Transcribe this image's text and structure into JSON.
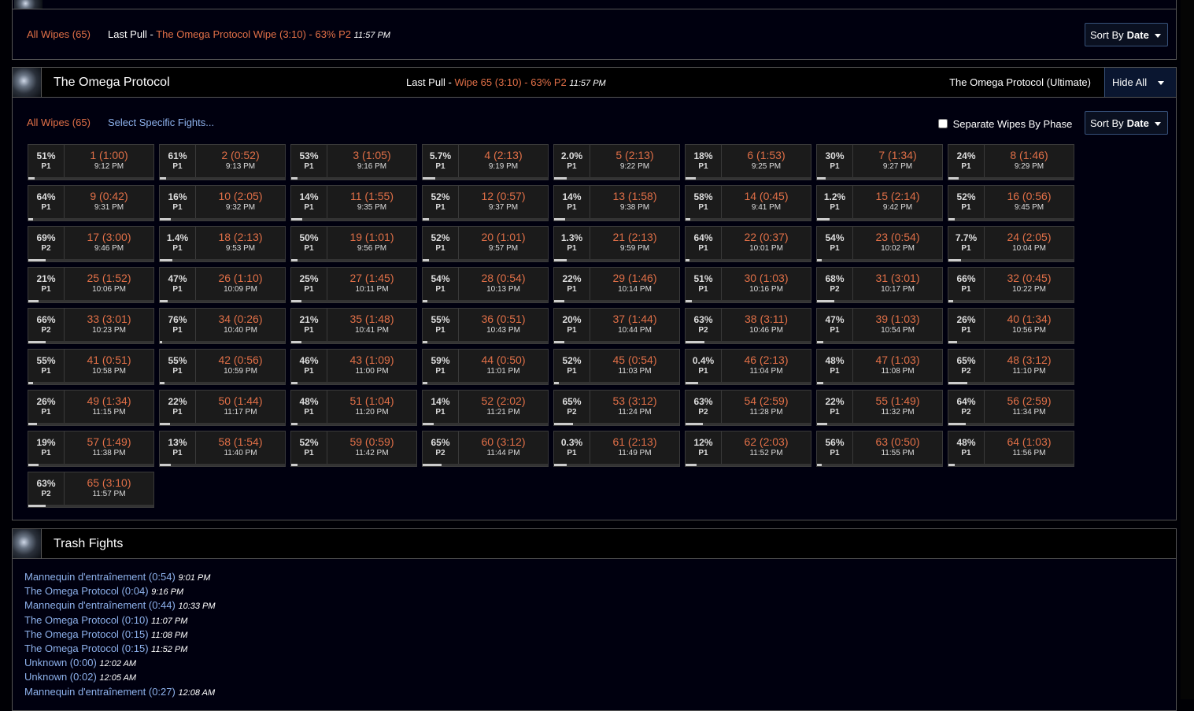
{
  "top": {
    "all_wipes": "All Wipes (65)",
    "last_pull_label": "Last Pull",
    "sep": " - ",
    "last_pull_link": "The Omega Protocol Wipe (3:10) - 63% P2",
    "last_pull_time": "11:57 PM",
    "sort_label": "Sort By",
    "sort_value": "Date"
  },
  "omega": {
    "title": "The Omega Protocol",
    "last_pull_label": "Last Pull",
    "sep": " - ",
    "last_pull_link": "Wipe 65 (3:10) - 63% P2",
    "last_pull_time": "11:57 PM",
    "difficulty": "The Omega Protocol (Ultimate)",
    "hide_all": "Hide All",
    "all_wipes": "All Wipes (65)",
    "select_fights": "Select Specific Fights...",
    "separate_label": "Separate Wipes By Phase",
    "sort_label": "Sort By",
    "sort_value": "Date"
  },
  "fights": [
    {
      "pct": "51%",
      "phase": "P1",
      "num": "1 (1:00)",
      "time": "9:12 PM",
      "frac": 0.05
    },
    {
      "pct": "61%",
      "phase": "P1",
      "num": "2 (0:52)",
      "time": "9:13 PM",
      "frac": 0.05
    },
    {
      "pct": "53%",
      "phase": "P1",
      "num": "3 (1:05)",
      "time": "9:16 PM",
      "frac": 0.05
    },
    {
      "pct": "5.7%",
      "phase": "P1",
      "num": "4 (2:13)",
      "time": "9:19 PM",
      "frac": 0.1
    },
    {
      "pct": "2.0%",
      "phase": "P1",
      "num": "5 (2:13)",
      "time": "9:22 PM",
      "frac": 0.1
    },
    {
      "pct": "18%",
      "phase": "P1",
      "num": "6 (1:53)",
      "time": "9:25 PM",
      "frac": 0.08
    },
    {
      "pct": "30%",
      "phase": "P1",
      "num": "7 (1:34)",
      "time": "9:27 PM",
      "frac": 0.07
    },
    {
      "pct": "24%",
      "phase": "P1",
      "num": "8 (1:46)",
      "time": "9:29 PM",
      "frac": 0.08
    },
    {
      "pct": "64%",
      "phase": "P1",
      "num": "9 (0:42)",
      "time": "9:31 PM",
      "frac": 0.04
    },
    {
      "pct": "16%",
      "phase": "P1",
      "num": "10 (2:05)",
      "time": "9:32 PM",
      "frac": 0.09
    },
    {
      "pct": "14%",
      "phase": "P1",
      "num": "11 (1:55)",
      "time": "9:35 PM",
      "frac": 0.09
    },
    {
      "pct": "52%",
      "phase": "P1",
      "num": "12 (0:57)",
      "time": "9:37 PM",
      "frac": 0.05
    },
    {
      "pct": "14%",
      "phase": "P1",
      "num": "13 (1:58)",
      "time": "9:38 PM",
      "frac": 0.09
    },
    {
      "pct": "58%",
      "phase": "P1",
      "num": "14 (0:45)",
      "time": "9:41 PM",
      "frac": 0.04
    },
    {
      "pct": "1.2%",
      "phase": "P1",
      "num": "15 (2:14)",
      "time": "9:42 PM",
      "frac": 0.1
    },
    {
      "pct": "52%",
      "phase": "P1",
      "num": "16 (0:56)",
      "time": "9:45 PM",
      "frac": 0.05
    },
    {
      "pct": "69%",
      "phase": "P2",
      "num": "17 (3:00)",
      "time": "9:46 PM",
      "frac": 0.14
    },
    {
      "pct": "1.4%",
      "phase": "P1",
      "num": "18 (2:13)",
      "time": "9:53 PM",
      "frac": 0.1
    },
    {
      "pct": "50%",
      "phase": "P1",
      "num": "19 (1:01)",
      "time": "9:56 PM",
      "frac": 0.05
    },
    {
      "pct": "52%",
      "phase": "P1",
      "num": "20 (1:01)",
      "time": "9:57 PM",
      "frac": 0.05
    },
    {
      "pct": "1.3%",
      "phase": "P1",
      "num": "21 (2:13)",
      "time": "9:59 PM",
      "frac": 0.1
    },
    {
      "pct": "64%",
      "phase": "P1",
      "num": "22 (0:37)",
      "time": "10:01 PM",
      "frac": 0.03
    },
    {
      "pct": "54%",
      "phase": "P1",
      "num": "23 (0:54)",
      "time": "10:02 PM",
      "frac": 0.04
    },
    {
      "pct": "7.7%",
      "phase": "P1",
      "num": "24 (2:05)",
      "time": "10:04 PM",
      "frac": 0.1
    },
    {
      "pct": "21%",
      "phase": "P1",
      "num": "25 (1:52)",
      "time": "10:06 PM",
      "frac": 0.08
    },
    {
      "pct": "47%",
      "phase": "P1",
      "num": "26 (1:10)",
      "time": "10:09 PM",
      "frac": 0.06
    },
    {
      "pct": "25%",
      "phase": "P1",
      "num": "27 (1:45)",
      "time": "10:11 PM",
      "frac": 0.08
    },
    {
      "pct": "54%",
      "phase": "P1",
      "num": "28 (0:54)",
      "time": "10:13 PM",
      "frac": 0.04
    },
    {
      "pct": "22%",
      "phase": "P1",
      "num": "29 (1:46)",
      "time": "10:14 PM",
      "frac": 0.08
    },
    {
      "pct": "51%",
      "phase": "P1",
      "num": "30 (1:03)",
      "time": "10:16 PM",
      "frac": 0.05
    },
    {
      "pct": "68%",
      "phase": "P2",
      "num": "31 (3:01)",
      "time": "10:17 PM",
      "frac": 0.14
    },
    {
      "pct": "66%",
      "phase": "P1",
      "num": "32 (0:45)",
      "time": "10:22 PM",
      "frac": 0.04
    },
    {
      "pct": "66%",
      "phase": "P2",
      "num": "33 (3:01)",
      "time": "10:23 PM",
      "frac": 0.14
    },
    {
      "pct": "76%",
      "phase": "P1",
      "num": "34 (0:26)",
      "time": "10:40 PM",
      "frac": 0.02
    },
    {
      "pct": "21%",
      "phase": "P1",
      "num": "35 (1:48)",
      "time": "10:41 PM",
      "frac": 0.08
    },
    {
      "pct": "55%",
      "phase": "P1",
      "num": "36 (0:51)",
      "time": "10:43 PM",
      "frac": 0.04
    },
    {
      "pct": "20%",
      "phase": "P1",
      "num": "37 (1:44)",
      "time": "10:44 PM",
      "frac": 0.08
    },
    {
      "pct": "63%",
      "phase": "P2",
      "num": "38 (3:11)",
      "time": "10:46 PM",
      "frac": 0.15
    },
    {
      "pct": "47%",
      "phase": "P1",
      "num": "39 (1:03)",
      "time": "10:54 PM",
      "frac": 0.05
    },
    {
      "pct": "26%",
      "phase": "P1",
      "num": "40 (1:34)",
      "time": "10:56 PM",
      "frac": 0.07
    },
    {
      "pct": "55%",
      "phase": "P1",
      "num": "41 (0:51)",
      "time": "10:58 PM",
      "frac": 0.04
    },
    {
      "pct": "55%",
      "phase": "P1",
      "num": "42 (0:56)",
      "time": "10:59 PM",
      "frac": 0.04
    },
    {
      "pct": "46%",
      "phase": "P1",
      "num": "43 (1:09)",
      "time": "11:00 PM",
      "frac": 0.05
    },
    {
      "pct": "59%",
      "phase": "P1",
      "num": "44 (0:50)",
      "time": "11:01 PM",
      "frac": 0.04
    },
    {
      "pct": "52%",
      "phase": "P1",
      "num": "45 (0:54)",
      "time": "11:03 PM",
      "frac": 0.04
    },
    {
      "pct": "0.4%",
      "phase": "P1",
      "num": "46 (2:13)",
      "time": "11:04 PM",
      "frac": 0.1
    },
    {
      "pct": "48%",
      "phase": "P1",
      "num": "47 (1:03)",
      "time": "11:08 PM",
      "frac": 0.05
    },
    {
      "pct": "65%",
      "phase": "P2",
      "num": "48 (3:12)",
      "time": "11:10 PM",
      "frac": 0.15
    },
    {
      "pct": "26%",
      "phase": "P1",
      "num": "49 (1:34)",
      "time": "11:15 PM",
      "frac": 0.07
    },
    {
      "pct": "22%",
      "phase": "P1",
      "num": "50 (1:44)",
      "time": "11:17 PM",
      "frac": 0.08
    },
    {
      "pct": "48%",
      "phase": "P1",
      "num": "51 (1:04)",
      "time": "11:20 PM",
      "frac": 0.05
    },
    {
      "pct": "14%",
      "phase": "P1",
      "num": "52 (2:02)",
      "time": "11:21 PM",
      "frac": 0.09
    },
    {
      "pct": "65%",
      "phase": "P2",
      "num": "53 (3:12)",
      "time": "11:24 PM",
      "frac": 0.15
    },
    {
      "pct": "63%",
      "phase": "P2",
      "num": "54 (2:59)",
      "time": "11:28 PM",
      "frac": 0.14
    },
    {
      "pct": "22%",
      "phase": "P1",
      "num": "55 (1:49)",
      "time": "11:32 PM",
      "frac": 0.08
    },
    {
      "pct": "64%",
      "phase": "P2",
      "num": "56 (2:59)",
      "time": "11:34 PM",
      "frac": 0.14
    },
    {
      "pct": "19%",
      "phase": "P1",
      "num": "57 (1:49)",
      "time": "11:38 PM",
      "frac": 0.08
    },
    {
      "pct": "13%",
      "phase": "P1",
      "num": "58 (1:54)",
      "time": "11:40 PM",
      "frac": 0.09
    },
    {
      "pct": "52%",
      "phase": "P1",
      "num": "59 (0:59)",
      "time": "11:42 PM",
      "frac": 0.05
    },
    {
      "pct": "65%",
      "phase": "P2",
      "num": "60 (3:12)",
      "time": "11:44 PM",
      "frac": 0.15
    },
    {
      "pct": "0.3%",
      "phase": "P1",
      "num": "61 (2:13)",
      "time": "11:49 PM",
      "frac": 0.1
    },
    {
      "pct": "12%",
      "phase": "P1",
      "num": "62 (2:03)",
      "time": "11:52 PM",
      "frac": 0.09
    },
    {
      "pct": "56%",
      "phase": "P1",
      "num": "63 (0:50)",
      "time": "11:55 PM",
      "frac": 0.04
    },
    {
      "pct": "48%",
      "phase": "P1",
      "num": "64 (1:03)",
      "time": "11:56 PM",
      "frac": 0.05
    },
    {
      "pct": "63%",
      "phase": "P2",
      "num": "65 (3:10)",
      "time": "11:57 PM",
      "frac": 0.14
    }
  ],
  "trash": {
    "title": "Trash Fights",
    "items": [
      {
        "label": "Mannequin d'entraînement (0:54)",
        "time": "9:01 PM"
      },
      {
        "label": "The Omega Protocol (0:04)",
        "time": "9:16 PM"
      },
      {
        "label": "Mannequin d'entraînement (0:44)",
        "time": "10:33 PM"
      },
      {
        "label": "The Omega Protocol (0:10)",
        "time": "11:07 PM"
      },
      {
        "label": "The Omega Protocol (0:15)",
        "time": "11:08 PM"
      },
      {
        "label": "The Omega Protocol (0:15)",
        "time": "11:52 PM"
      },
      {
        "label": "Unknown (0:00)",
        "time": "12:02 AM"
      },
      {
        "label": "Unknown (0:02)",
        "time": "12:05 AM"
      },
      {
        "label": "Mannequin d'entraînement (0:27)",
        "time": "12:08 AM"
      }
    ]
  }
}
